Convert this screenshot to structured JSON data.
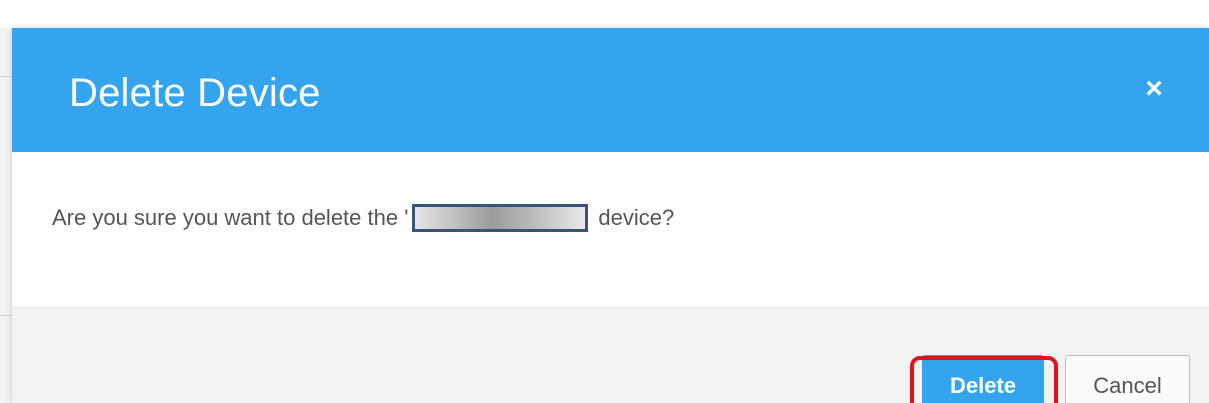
{
  "dialog": {
    "title": "Delete Device",
    "close_symbol": "×",
    "message_prefix": "Are you sure you want to delete the '",
    "message_suffix": " device?",
    "delete_label": "Delete",
    "cancel_label": "Cancel"
  },
  "colors": {
    "header": "#34a4ee",
    "primary_button": "#34a4ee",
    "highlight": "#e0121b",
    "redaction_border": "#3a5479"
  },
  "icons": {
    "close": "close-icon"
  }
}
